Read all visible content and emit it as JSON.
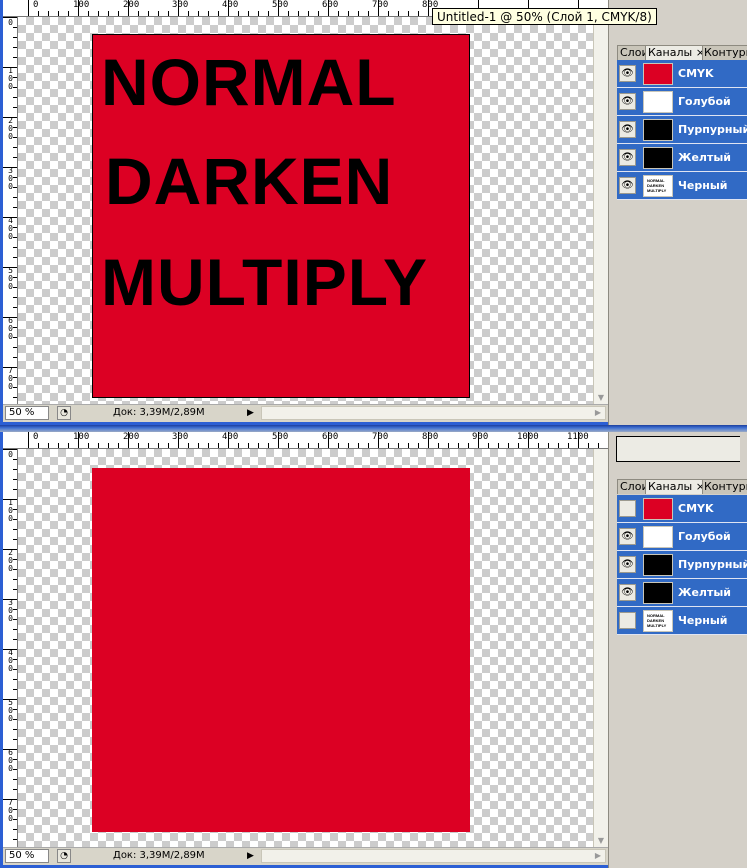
{
  "tooltip": "Untitled-1 @ 50% (Слой 1, CMYK/8)",
  "ruler": {
    "top_labels": [
      "0",
      "100",
      "200",
      "300",
      "400",
      "500",
      "600",
      "700",
      "800",
      "900",
      "1000",
      "1100"
    ],
    "left_labels": [
      "0",
      "100",
      "200",
      "300",
      "400",
      "500",
      "600",
      "700"
    ]
  },
  "document": {
    "fill_color": "#dc0023",
    "lines": [
      "NORMAL",
      "DARKEN",
      "MULTIPLY"
    ]
  },
  "status": {
    "zoom": "50 %",
    "doc_size": "Док: 3,39M/2,89M"
  },
  "panel": {
    "tabs": [
      "Слои",
      "Каналы",
      "Контуры"
    ],
    "tab_close": "×"
  },
  "top_channels": [
    {
      "name": "CMYK",
      "visible": true,
      "thumb": "cmyk"
    },
    {
      "name": "Голубой",
      "visible": true,
      "thumb": "white"
    },
    {
      "name": "Пурпурный",
      "visible": true,
      "thumb": "black"
    },
    {
      "name": "Желтый",
      "visible": true,
      "thumb": "black"
    },
    {
      "name": "Черный",
      "visible": true,
      "thumb": "text"
    }
  ],
  "bottom_channels": [
    {
      "name": "CMYK",
      "visible": false,
      "thumb": "cmyk"
    },
    {
      "name": "Голубой",
      "visible": true,
      "thumb": "white"
    },
    {
      "name": "Пурпурный",
      "visible": true,
      "thumb": "black"
    },
    {
      "name": "Желтый",
      "visible": true,
      "thumb": "black"
    },
    {
      "name": "Черный",
      "visible": false,
      "thumb": "text"
    }
  ]
}
